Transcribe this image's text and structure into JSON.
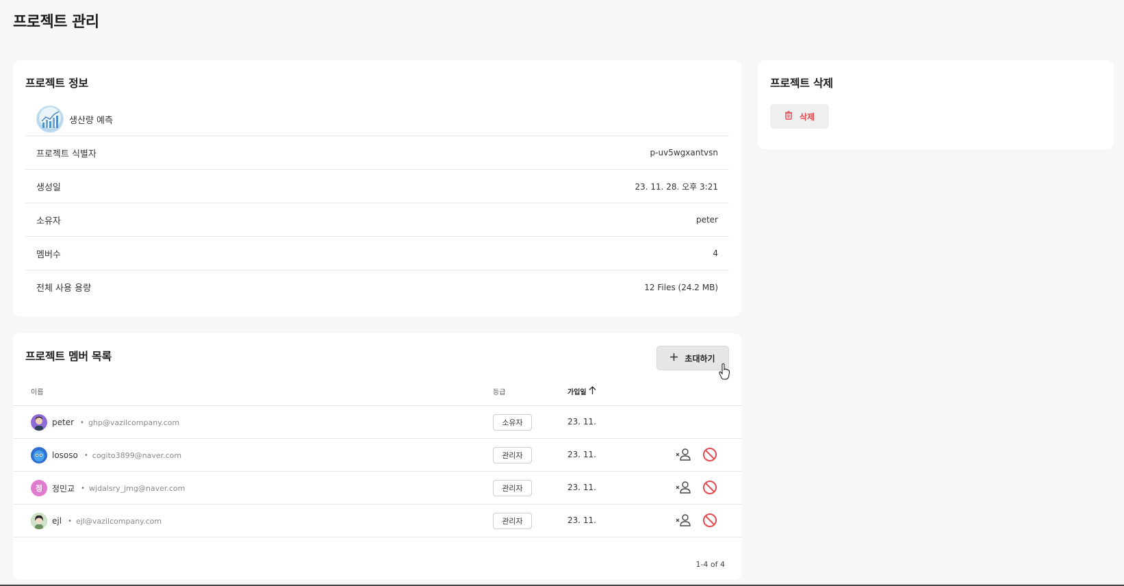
{
  "page": {
    "title": "프로젝트 관리"
  },
  "info": {
    "title": "프로젝트 정보",
    "project_name": "생산량 예측",
    "rows": [
      {
        "label": "프로젝트 식별자",
        "value": "p-uv5wgxantvsn"
      },
      {
        "label": "생성일",
        "value": "23. 11. 28. 오후 3:21"
      },
      {
        "label": "소유자",
        "value": "peter"
      },
      {
        "label": "멤버수",
        "value": "4"
      },
      {
        "label": "전체 사용 용량",
        "value": "12 Files (24.2 MB)"
      }
    ]
  },
  "delete": {
    "title": "프로젝트 삭제",
    "button_label": "삭제",
    "icon": "trash-icon"
  },
  "members": {
    "title": "프로젝트 멤버 목록",
    "invite_label": "초대하기",
    "columns": {
      "name": "이름",
      "role": "등급",
      "joined": "가입일"
    },
    "rows": [
      {
        "name": "peter",
        "email": "ghp@vazilcompany.com",
        "role": "소유자",
        "joined": "23. 11.",
        "avatar": "photo",
        "avatar_color": "#8e6bd6",
        "actions": false
      },
      {
        "name": "lososo",
        "email": "cogito3899@naver.com",
        "role": "관리자",
        "joined": "23. 11.",
        "avatar": "photo",
        "avatar_color": "#2f6fd0",
        "actions": true
      },
      {
        "name": "정민교",
        "email": "wjdalsry_jmg@naver.com",
        "role": "관리자",
        "joined": "23. 11.",
        "avatar": "정",
        "avatar_color": "#e07bd0",
        "actions": true
      },
      {
        "name": "ejl",
        "email": "ejl@vazilcompany.com",
        "role": "관리자",
        "joined": "23. 11.",
        "avatar": "photo",
        "avatar_color": "#5f8a5a",
        "actions": true
      }
    ],
    "pagination": "1-4 of 4"
  },
  "colors": {
    "danger": "#e5484d",
    "background": "#f6f7f9"
  }
}
